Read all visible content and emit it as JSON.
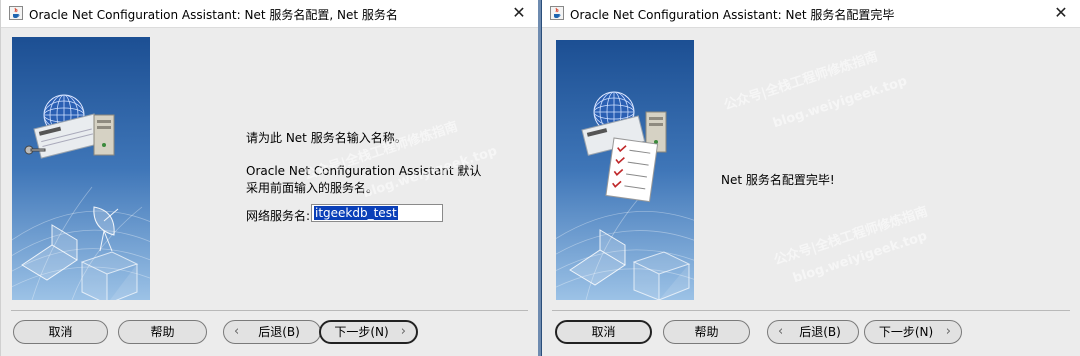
{
  "left_dialog": {
    "title": "Oracle Net Configuration Assistant: Net 服务名配置, Net 服务名",
    "prompt": "请为此 Net 服务名输入名称。",
    "description_line1": "Oracle Net Configuration Assistant 默认",
    "description_line2": "采用前面输入的服务名。",
    "field_label": "网络服务名:",
    "field_value": "itgeekdb_test",
    "buttons": {
      "cancel": "取消",
      "help": "帮助",
      "back": "后退(B)",
      "next": "下一步(N)"
    }
  },
  "right_dialog": {
    "title": "Oracle Net Configuration Assistant: Net 服务名配置完毕",
    "message": "Net 服务名配置完毕!",
    "buttons": {
      "cancel": "取消",
      "help": "帮助",
      "back": "后退(B)",
      "next": "下一步(N)"
    }
  },
  "watermark": {
    "text1": "公众号|全栈工程师修炼指南",
    "text2": "blog.weiyigeek.top"
  },
  "colors": {
    "dialog_bg": "#ececec",
    "selection": "#0a3fb8",
    "art_top": "#1c4f93",
    "art_bottom": "#8fb7e0"
  }
}
